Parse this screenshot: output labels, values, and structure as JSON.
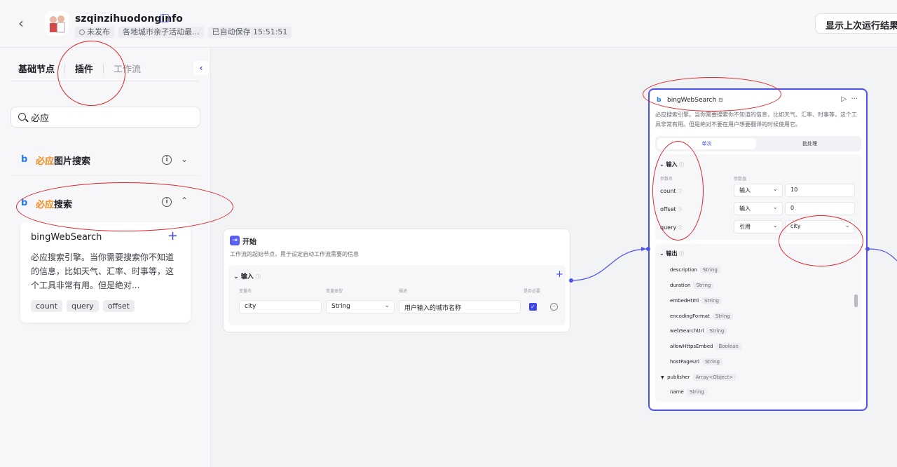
{
  "header": {
    "title": "szqinzihuodonginfo",
    "status": "未发布",
    "description": "各地城市亲子活动最...",
    "autosave": "已自动保存 15:51:51",
    "run_result_label": "显示上次运行结果"
  },
  "sidebar": {
    "tabs": [
      {
        "label": "基础节点"
      },
      {
        "label": "插件"
      },
      {
        "label": "工作流"
      }
    ],
    "search": {
      "value": "必应"
    },
    "plugins": [
      {
        "highlight": "必应",
        "rest": "图片搜索"
      },
      {
        "highlight": "必应",
        "rest": "搜索"
      }
    ],
    "tool": {
      "name": "bingWebSearch",
      "description": "必应搜索引擎。当你需要搜索你不知道的信息，比如天气、汇率、时事等，这个工具非常有用。但是绝对...",
      "params": [
        "count",
        "query",
        "offset"
      ]
    }
  },
  "start_node": {
    "title": "开始",
    "description": "工作流的起始节点，用于设定启动工作流需要的信息",
    "input_label": "输入",
    "col_var_name": "变量名",
    "col_var_type": "变量类型",
    "col_desc": "描述",
    "col_required": "是否必要",
    "field_name": "city",
    "field_type": "String",
    "field_desc": "用户输入的城市名称"
  },
  "plugin_node": {
    "title": "bingWebSearch",
    "description": "必应搜索引擎。当你需要搜索你不知道的信息，比如天气、汇率、时事等，这个工具非常有用。但是绝对不要在用户想要翻译的时候使用它。",
    "mode_single": "单次",
    "mode_batch": "批处理",
    "input_label": "输入",
    "col_param_name": "参数名",
    "col_param_value": "参数值",
    "inputs": [
      {
        "name": "count",
        "mode": "输入",
        "value": "10"
      },
      {
        "name": "offset",
        "mode": "输入",
        "value": "0"
      },
      {
        "name": "query",
        "mode": "引用",
        "value": "city"
      }
    ],
    "output_label": "输出",
    "outputs": [
      {
        "name": "description",
        "type": "String"
      },
      {
        "name": "duration",
        "type": "String"
      },
      {
        "name": "embedHtml",
        "type": "String"
      },
      {
        "name": "encodingFormat",
        "type": "String"
      },
      {
        "name": "webSearchUrl",
        "type": "String"
      },
      {
        "name": "allowHttpsEmbed",
        "type": "Boolean"
      },
      {
        "name": "hostPageUrl",
        "type": "String"
      },
      {
        "name": "publisher",
        "type": "Array<Object>"
      },
      {
        "name": "name",
        "type": "String"
      }
    ]
  },
  "colors": {
    "accent": "#4d53e8",
    "highlight": "#f08c1e",
    "annotation": "#d9262b"
  }
}
